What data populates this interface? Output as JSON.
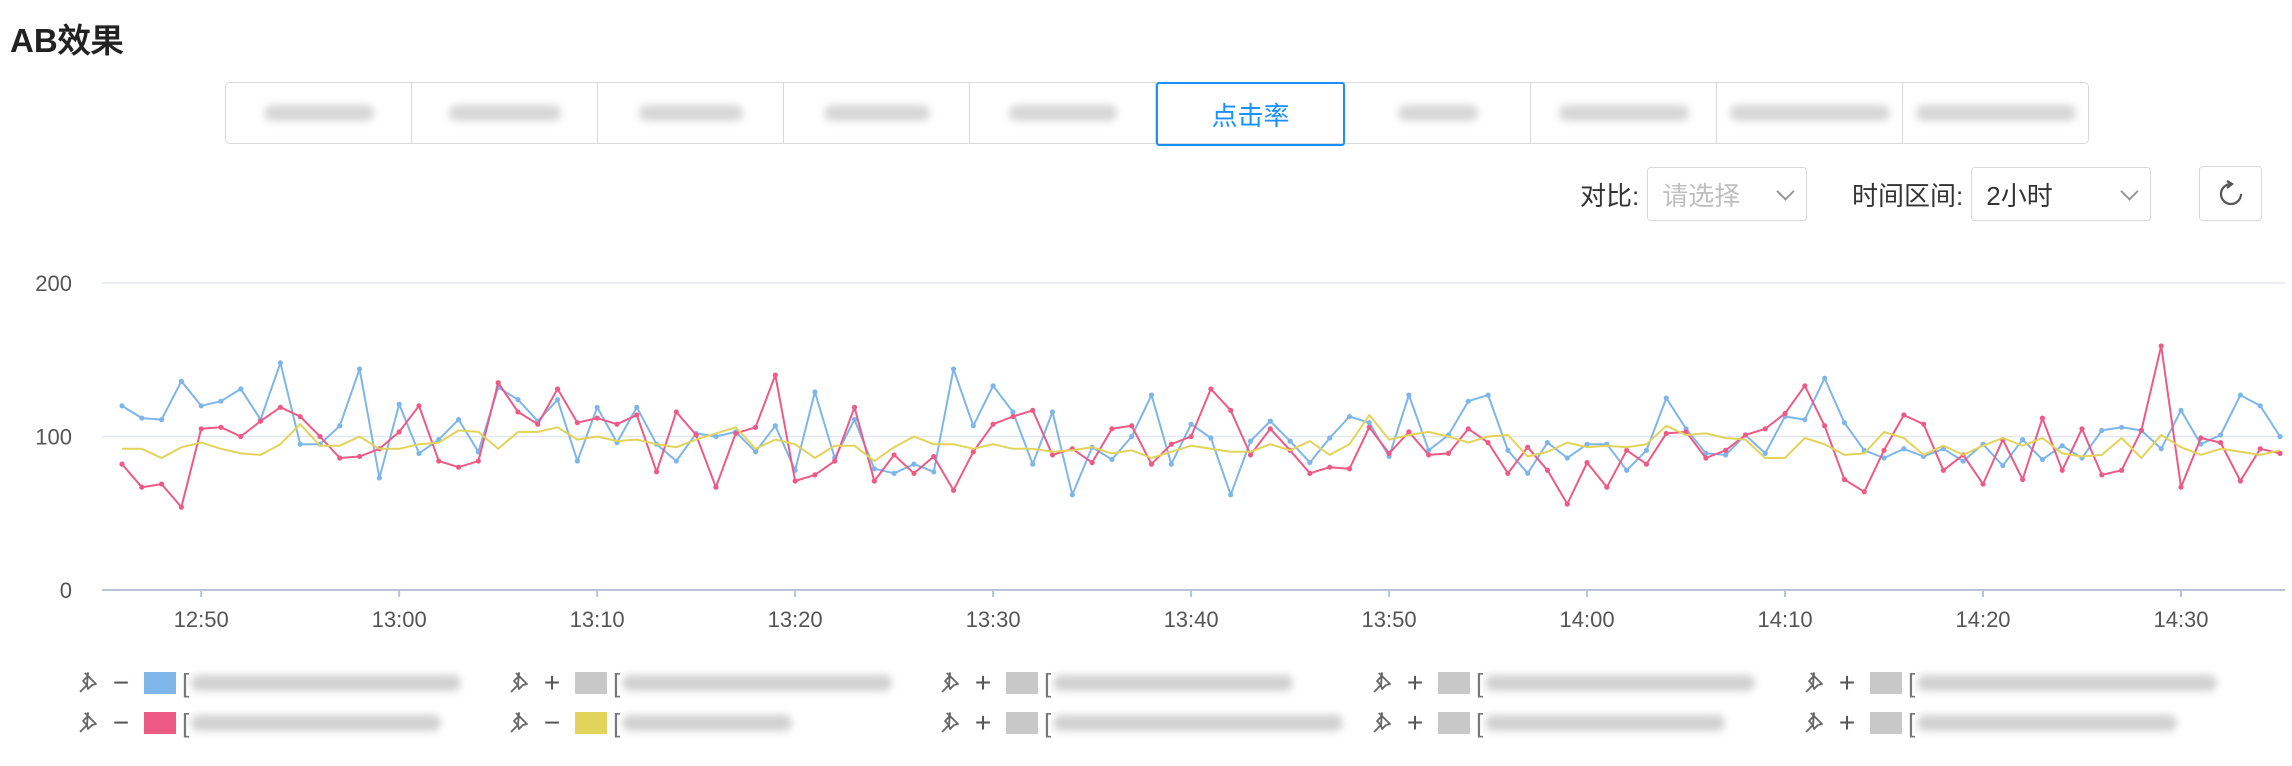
{
  "page": {
    "title": "AB效果"
  },
  "tabs": [
    {
      "label": "",
      "active": false
    },
    {
      "label": "",
      "active": false
    },
    {
      "label": "",
      "active": false
    },
    {
      "label": "",
      "active": false
    },
    {
      "label": "",
      "active": false
    },
    {
      "label": "点击率",
      "active": true
    },
    {
      "label": "",
      "active": false
    },
    {
      "label": "",
      "active": false
    },
    {
      "label": "",
      "active": false
    },
    {
      "label": "",
      "active": false
    }
  ],
  "controls": {
    "compare_label": "对比:",
    "compare_placeholder": "请选择",
    "time_label": "时间区间:",
    "time_value": "2小时"
  },
  "legend": [
    {
      "op": "−",
      "color": "#7eb6e9",
      "label": ""
    },
    {
      "op": "+",
      "color": "#c8c8c8",
      "label": ""
    },
    {
      "op": "+",
      "color": "#c8c8c8",
      "label": ""
    },
    {
      "op": "+",
      "color": "#c8c8c8",
      "label": ""
    },
    {
      "op": "+",
      "color": "#c8c8c8",
      "label": ""
    },
    {
      "op": "−",
      "color": "#ee5a86",
      "label": ""
    },
    {
      "op": "−",
      "color": "#e2d35a",
      "label": ""
    },
    {
      "op": "+",
      "color": "#c8c8c8",
      "label": ""
    },
    {
      "op": "+",
      "color": "#c8c8c8",
      "label": ""
    },
    {
      "op": "+",
      "color": "#c8c8c8",
      "label": ""
    }
  ],
  "chart_data": {
    "type": "line",
    "ylim": [
      0,
      200
    ],
    "yticks": [
      0,
      100,
      200
    ],
    "x_start": "12:46",
    "x_step_minutes": 1,
    "xticks": [
      "12:50",
      "13:00",
      "13:10",
      "13:20",
      "13:30",
      "13:40",
      "13:50",
      "14:00",
      "14:10",
      "14:20",
      "14:30"
    ],
    "grid": true,
    "series": [
      {
        "color": "#7eb6e9",
        "values": [
          120,
          112,
          111,
          136,
          120,
          123,
          131,
          111,
          148,
          95,
          95,
          107,
          144,
          73,
          121,
          89,
          98,
          111,
          90,
          132,
          124,
          110,
          124,
          84,
          119,
          96,
          119,
          95,
          84,
          102,
          100,
          103,
          90,
          107,
          78,
          129,
          86,
          111,
          79,
          76,
          82,
          77,
          144,
          107,
          133,
          116,
          82,
          116,
          62,
          93,
          85,
          100,
          127,
          82,
          108,
          99,
          62,
          97,
          110,
          97,
          83,
          99,
          113,
          109,
          87,
          127,
          91,
          101,
          123,
          127,
          91,
          76,
          96,
          86,
          95,
          95,
          78,
          91,
          125,
          105,
          89,
          88,
          101,
          89,
          113,
          111,
          138,
          109,
          91,
          86,
          92,
          87,
          92,
          84,
          95,
          81,
          98,
          85,
          94,
          86,
          104,
          106,
          104,
          92,
          117,
          95,
          101,
          127,
          120,
          100
        ]
      },
      {
        "color": "#ee5a86",
        "values": [
          82,
          67,
          69,
          54,
          105,
          106,
          100,
          110,
          119,
          113,
          100,
          86,
          87,
          92,
          103,
          120,
          84,
          80,
          84,
          135,
          116,
          108,
          131,
          109,
          112,
          108,
          114,
          77,
          116,
          101,
          67,
          102,
          106,
          140,
          71,
          75,
          84,
          119,
          71,
          88,
          76,
          87,
          65,
          90,
          108,
          113,
          117,
          88,
          92,
          83,
          105,
          107,
          82,
          95,
          100,
          131,
          117,
          88,
          105,
          91,
          76,
          80,
          79,
          106,
          89,
          103,
          88,
          89,
          105,
          96,
          76,
          93,
          78,
          56,
          83,
          67,
          91,
          82,
          102,
          103,
          86,
          91,
          101,
          105,
          115,
          133,
          107,
          72,
          64,
          91,
          114,
          108,
          78,
          88,
          69,
          98,
          72,
          112,
          78,
          105,
          75,
          78,
          104,
          159,
          67,
          99,
          96,
          71,
          92,
          89
        ]
      },
      {
        "color": "#e2d35a",
        "values": [
          92,
          92,
          86,
          93,
          96,
          92,
          89,
          88,
          95,
          108,
          94,
          94,
          100,
          92,
          92,
          95,
          96,
          104,
          103,
          92,
          103,
          103,
          106,
          98,
          100,
          97,
          98,
          95,
          93,
          98,
          102,
          106,
          92,
          98,
          95,
          86,
          94,
          94,
          84,
          93,
          100,
          95,
          95,
          92,
          95,
          92,
          92,
          90,
          91,
          93,
          89,
          91,
          86,
          90,
          94,
          92,
          90,
          90,
          95,
          91,
          97,
          88,
          95,
          114,
          98,
          101,
          103,
          100,
          96,
          100,
          101,
          87,
          90,
          96,
          93,
          94,
          93,
          95,
          107,
          101,
          102,
          99,
          98,
          86,
          86,
          99,
          95,
          88,
          89,
          103,
          99,
          88,
          94,
          88,
          94,
          99,
          94,
          99,
          89,
          87,
          88,
          99,
          86,
          101,
          93,
          88,
          92,
          90,
          88,
          91
        ]
      }
    ]
  }
}
